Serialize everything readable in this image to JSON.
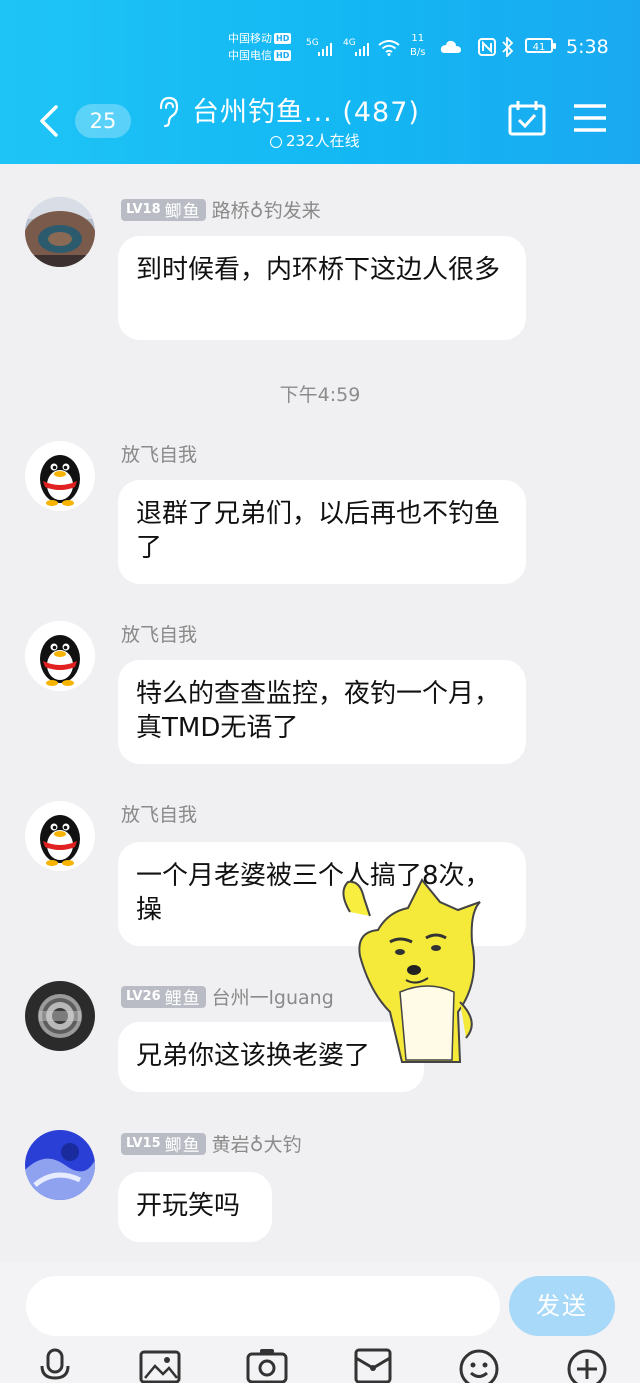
{
  "status_bar": {
    "carrier1": "中国移动",
    "carrier2": "中国电信",
    "hd": "HD",
    "sig1_label": "5G",
    "sig2_label": "4G",
    "net_speed_value": "11",
    "net_speed_unit": "B/s",
    "battery": "41",
    "time": "5:38"
  },
  "header": {
    "unread_count": "25",
    "title": "台州钓鱼... (487)",
    "online_text": "232人在线"
  },
  "messages": [
    {
      "level": "LV18",
      "level_title": "鲫鱼",
      "sender": "路桥♁钓发来",
      "text": "到时候看，内环桥下这边人很多"
    },
    {
      "sender": "放飞自我",
      "text": "退群了兄弟们，以后再也不钓鱼了"
    },
    {
      "sender": "放飞自我",
      "text": "特么的查查监控，夜钓一个月，真TMD无语了"
    },
    {
      "sender": "放飞自我",
      "text": "一个月老婆被三个人搞了8次，操"
    },
    {
      "level": "LV26",
      "level_title": "鲤鱼",
      "sender": "台州一lguang",
      "text": "兄弟你这该换老婆了"
    },
    {
      "level": "LV15",
      "level_title": "鲫鱼",
      "sender": "黄岩♁大钓",
      "text": "开玩笑吗"
    }
  ],
  "timestamp": "下午4:59",
  "input": {
    "send_label": "发送"
  },
  "colors": {
    "header_blue": "#13b7f3",
    "send_disabled": "#a9d9f8",
    "chat_bg": "#f0f0f2"
  },
  "toolbar_icons": [
    "mic-icon",
    "image-icon",
    "camera-icon",
    "red-packet-icon",
    "emoji-icon",
    "plus-icon"
  ]
}
